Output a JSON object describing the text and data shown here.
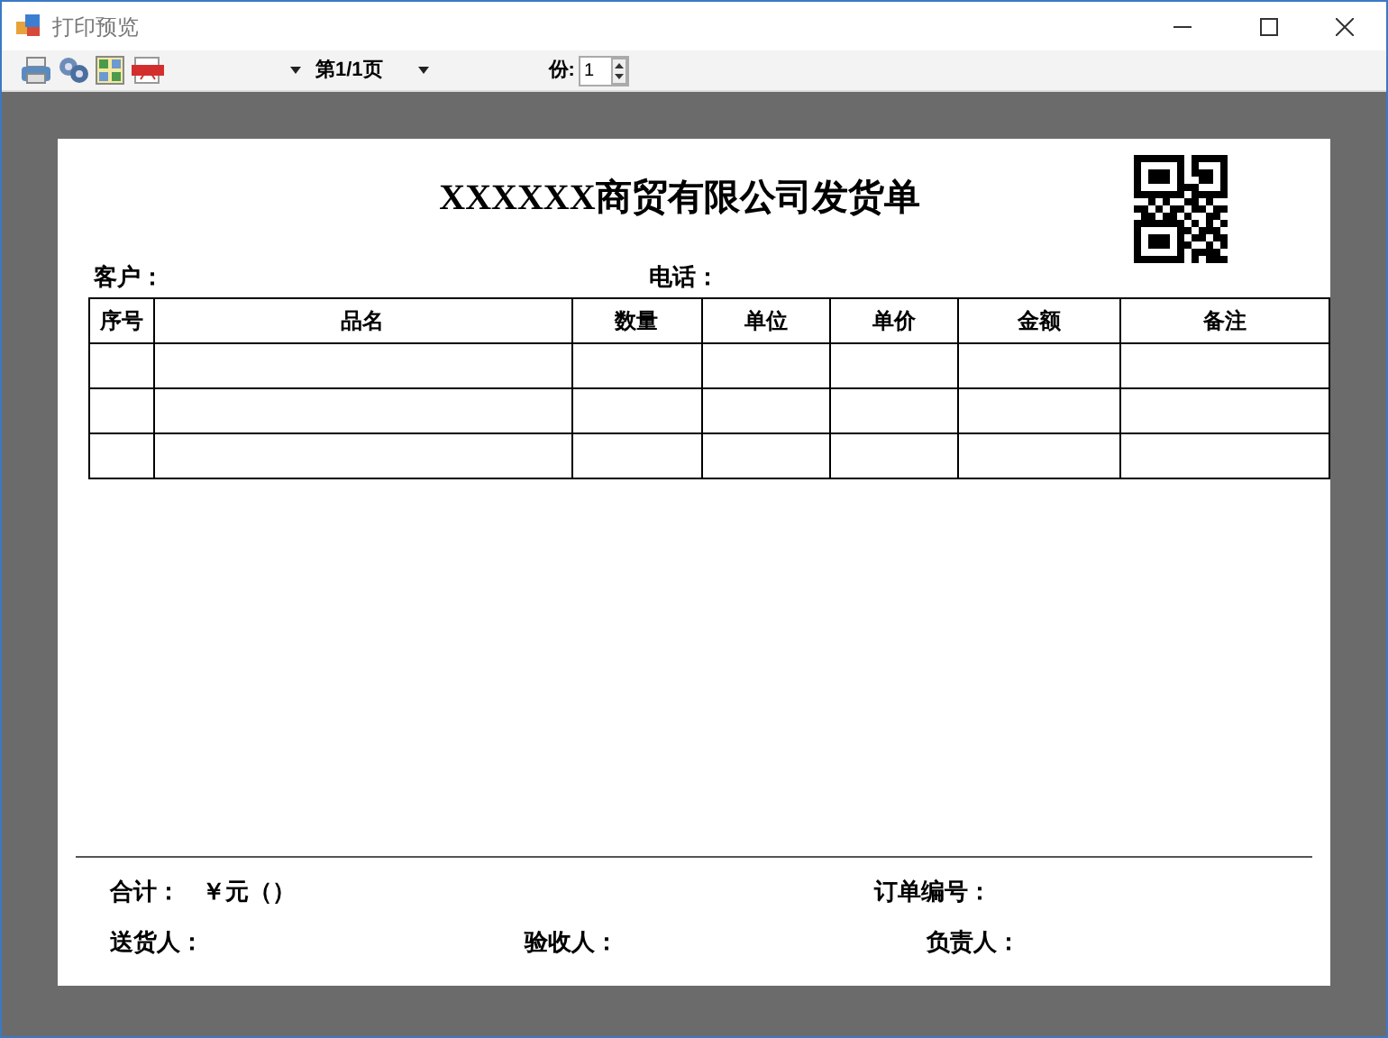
{
  "window": {
    "title": "打印预览"
  },
  "toolbar": {
    "page": "第1/1页",
    "copies_label": "份:",
    "copies_value": "1"
  },
  "document": {
    "title": "XXXXXX商贸有限公司发货单",
    "customer_label": "客户：",
    "phone_label": "电话：",
    "table": {
      "columns": [
        "序号",
        "品名",
        "数量",
        "单位",
        "单价",
        "金额",
        "备注"
      ]
    },
    "footer": {
      "total_label": "合计：",
      "total_value": "￥元（）",
      "order_label": "订单编号：",
      "deliverer_label": "送货人：",
      "receiver_label": "验收人：",
      "manager_label": "负责人："
    }
  }
}
